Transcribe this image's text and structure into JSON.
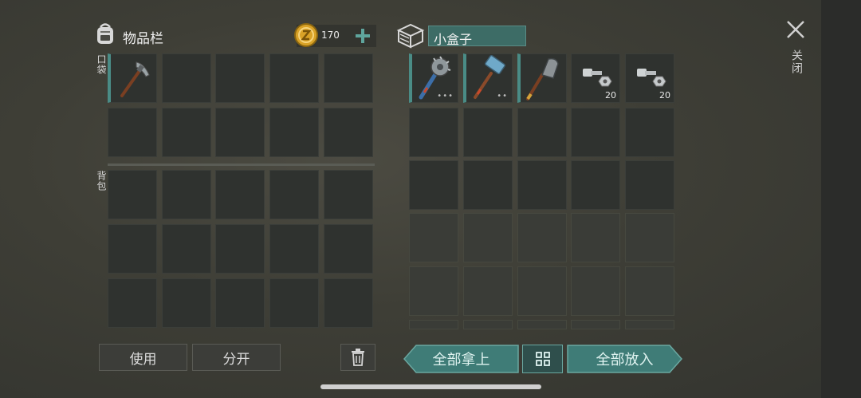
{
  "inventory": {
    "title": "物品栏",
    "coin_amount": "170",
    "pocket_label": "口袋",
    "backpack_label": "背包",
    "pocket_items": [
      {
        "icon": "pickaxe-icon",
        "name": "pickaxe"
      }
    ]
  },
  "container": {
    "name": "小盒子",
    "items": [
      {
        "icon": "sawblade-hammer-icon",
        "badge": "•••"
      },
      {
        "icon": "sledgehammer-icon",
        "badge": "••"
      },
      {
        "icon": "shovel-icon",
        "badge": ""
      },
      {
        "icon": "bolt-nut-icon",
        "count": "20"
      },
      {
        "icon": "bolt-nut-icon",
        "count": "20"
      }
    ]
  },
  "buttons": {
    "use": "使用",
    "split": "分开",
    "take_all": "全部拿上",
    "put_all": "全部放入",
    "close": "关闭"
  },
  "colors": {
    "accent_teal": "#3f7c77",
    "coin_gold": "#e0a92a"
  }
}
